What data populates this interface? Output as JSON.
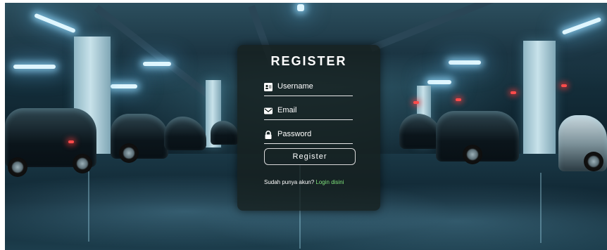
{
  "form": {
    "title": "REGISTER",
    "fields": [
      {
        "label": "Username",
        "icon": "id-card-icon"
      },
      {
        "label": "Email",
        "icon": "envelope-icon"
      },
      {
        "label": "Password",
        "icon": "lock-icon"
      }
    ],
    "submit_label": "Register",
    "footer_text": "Sudah punya akun?",
    "login_link": "Login disini"
  },
  "colors": {
    "panel_bg": "#16201e",
    "link": "#7ee07a",
    "text": "#ffffff"
  }
}
